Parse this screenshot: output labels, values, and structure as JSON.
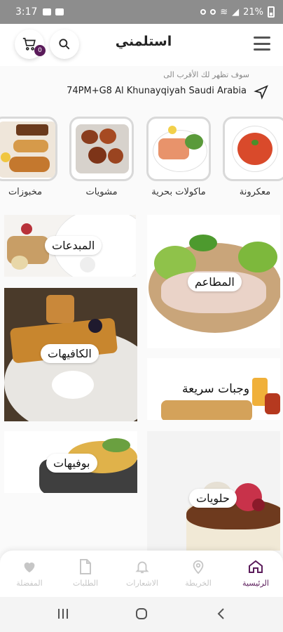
{
  "status_bar": {
    "time": "3:17",
    "battery": "21%"
  },
  "header": {
    "title": "استلمني",
    "cart_count": "0"
  },
  "location": {
    "hint": "سوف تظهر لك الأقرب الى",
    "address": "74PM+G8 Al Khunayqiyah Saudi Arabia"
  },
  "categories": [
    {
      "label": "معكرونة"
    },
    {
      "label": "ماكولات بحرية"
    },
    {
      "label": "مشويات"
    },
    {
      "label": "مخبوزات"
    }
  ],
  "tiles": {
    "restaurants": "المطاعم",
    "starters": "المبدعات",
    "cafes": "الكافيهات",
    "fast_food": "وجبات سريعة",
    "buffets": "بوفيهات",
    "desserts": "حلويات"
  },
  "bottom_nav": {
    "home": "الرئيسية",
    "map": "الخريطة",
    "notifications": "الاشعارات",
    "orders": "الطلبات",
    "favorites": "المفضلة"
  },
  "colors": {
    "accent": "#5a1b5a",
    "inactive": "#c6c6c6",
    "status_bar": "#8d8d8d"
  }
}
